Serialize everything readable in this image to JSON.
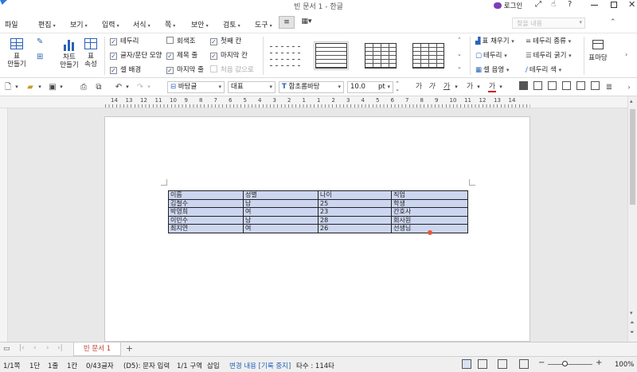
{
  "title_bar": {
    "title": "빈 문서 1 - 한글",
    "login_label": "로그인",
    "help_label": "?"
  },
  "menu": {
    "items": [
      {
        "label": "파일",
        "caret": false
      },
      {
        "label": "편집",
        "caret": true
      },
      {
        "label": "보기",
        "caret": true
      },
      {
        "label": "입력",
        "caret": true
      },
      {
        "label": "서식",
        "caret": true
      },
      {
        "label": "쪽",
        "caret": true
      },
      {
        "label": "보안",
        "caret": true
      },
      {
        "label": "검토",
        "caret": true
      },
      {
        "label": "도구",
        "caret": true
      }
    ],
    "search_placeholder": "찾을 내용"
  },
  "ribbon": {
    "table_button": "표\n만들기",
    "chart_button": "차트\n만들기",
    "table_props_button": "표\n속성",
    "checks_col1": [
      {
        "label": "테두리",
        "checked": true
      },
      {
        "label": "글자/문단 모양",
        "checked": true
      },
      {
        "label": "셀 배경",
        "checked": true
      }
    ],
    "checks_col2": [
      {
        "label": "회색조",
        "checked": false
      },
      {
        "label": "제목 줄",
        "checked": true
      },
      {
        "label": "마지막 줄",
        "checked": true
      }
    ],
    "checks_col3": [
      {
        "label": "첫째 칸",
        "checked": true
      },
      {
        "label": "마지막 칸",
        "checked": true
      },
      {
        "label": "처음 값으로",
        "checked": false,
        "disabled": true
      }
    ],
    "right_tools": [
      {
        "label": "표 채우기"
      },
      {
        "label": "테두리"
      },
      {
        "label": "셀 음영"
      }
    ],
    "border_tools": [
      {
        "label": "테두리 종류"
      },
      {
        "label": "테두리 굵기"
      },
      {
        "label": "테두리 색"
      }
    ],
    "layout_button": "표마당"
  },
  "toolbar": {
    "style": "바탕글",
    "lang": "대표",
    "font": "함초롬바탕",
    "size": "10.0",
    "unit": "pt",
    "font_color": "#d11a1a"
  },
  "ruler": {
    "ticks": [
      "14",
      "13",
      "12",
      "11",
      "10",
      "9",
      "8",
      "7",
      "6",
      "5",
      "4",
      "3",
      "2",
      "1",
      "1",
      "2",
      "3",
      "4",
      "5",
      "6",
      "7",
      "8",
      "9",
      "10",
      "11",
      "12",
      "13",
      "14"
    ]
  },
  "document": {
    "table": {
      "rows": [
        [
          "이름",
          "성별",
          "나이",
          "직업"
        ],
        [
          "김철수",
          "남",
          "25",
          "학생"
        ],
        [
          "박영희",
          "여",
          "23",
          "간호사"
        ],
        [
          "이민수",
          "남",
          "28",
          "회사원"
        ],
        [
          "최지연",
          "여",
          "26",
          "선생님"
        ]
      ],
      "cell_bg": "#cdd6f0"
    }
  },
  "tabs": {
    "items": [
      {
        "label": "빈 문서 1",
        "active": true
      }
    ],
    "add_label": "+"
  },
  "status": {
    "page": "1/1쪽",
    "section": "1단",
    "line": "1줄",
    "col": "1칸",
    "chars": "0/43글자",
    "mode": "(D5): 문자 입력",
    "area": "1/1 구역",
    "insert": "삽입",
    "track": "변경 내용 [기록 중지]",
    "count": "타수 : 114타",
    "zoom": "100%"
  }
}
